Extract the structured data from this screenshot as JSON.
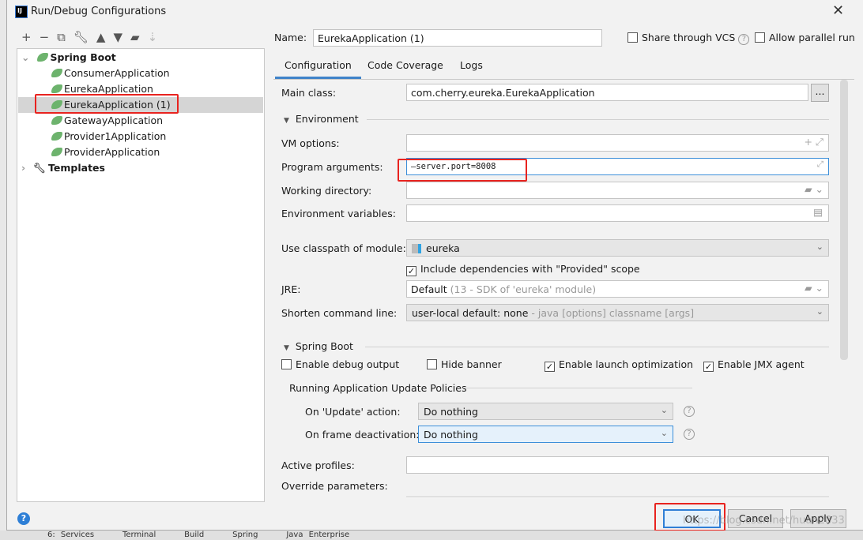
{
  "window": {
    "title": "Run/Debug Configurations",
    "app_icon": "IJ"
  },
  "toolbar": {
    "icons": [
      "plus-icon",
      "minus-icon",
      "copy-icon",
      "wrench-icon",
      "arrow-up-icon",
      "arrow-down-icon",
      "new-folder-icon",
      "sort-az-icon"
    ]
  },
  "tree": {
    "group": "Spring Boot",
    "items": [
      "ConsumerApplication",
      "EurekaApplication",
      "EurekaApplication (1)",
      "GatewayApplication",
      "Provider1Application",
      "ProviderApplication"
    ],
    "selected": "EurekaApplication (1)",
    "templates": "Templates"
  },
  "header": {
    "name_label": "Name:",
    "name_value": "EurekaApplication (1)",
    "share_label": "Share through VCS",
    "share_checked": false,
    "parallel_label": "Allow parallel run",
    "parallel_checked": false
  },
  "tabs": [
    "Configuration",
    "Code Coverage",
    "Logs"
  ],
  "config": {
    "main_class_label": "Main class:",
    "main_class_value": "com.cherry.eureka.EurekaApplication",
    "browse": "...",
    "environment_label": "Environment",
    "vm_label": "VM options:",
    "vm_value": "",
    "args_label": "Program arguments:",
    "args_value": "—server.port=8008",
    "workdir_label": "Working directory:",
    "workdir_value": "",
    "envvars_label": "Environment variables:",
    "envvars_value": "",
    "classpath_label": "Use classpath of module:",
    "classpath_value": "eureka",
    "include_label": "Include dependencies with \"Provided\" scope",
    "include_checked": true,
    "jre_label": "JRE:",
    "jre_value": "Default",
    "jre_hint": "(13 - SDK of 'eureka' module)",
    "shorten_label": "Shorten command line:",
    "shorten_value": "user-local default: none",
    "shorten_hint": "- java [options] classname [args]",
    "springboot_label": "Spring Boot",
    "debug_label": "Enable debug output",
    "debug_checked": false,
    "banner_label": "Hide banner",
    "banner_checked": false,
    "launch_label": "Enable launch optimization",
    "launch_checked": true,
    "jmx_label": "Enable JMX agent",
    "jmx_checked": true,
    "policies_label": "Running Application Update Policies",
    "update_label": "On 'Update' action:",
    "update_value": "Do nothing",
    "frame_label": "On frame deactivation:",
    "frame_value": "Do nothing",
    "profiles_label": "Active profiles:",
    "profiles_value": "",
    "override_label": "Override parameters:"
  },
  "buttons": {
    "ok": "OK",
    "cancel": "Cancel",
    "apply": "Apply"
  },
  "watermark": "https://blog.csdn.net/huan2833",
  "ide_bottom": [
    "6: Services",
    "Terminal",
    "Build",
    "Spring",
    "Java Enterprise"
  ]
}
